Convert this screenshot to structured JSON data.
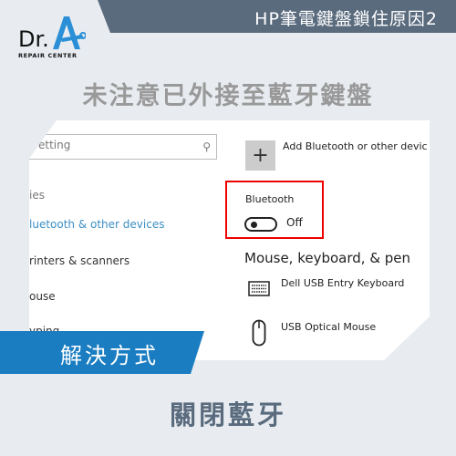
{
  "header": {
    "title": "HP筆電鍵盤鎖住原因2"
  },
  "logo": {
    "text": "Dr.A",
    "subtitle": "REPAIR CENTER"
  },
  "headline": "未注意已外接至藍牙鍵盤",
  "screenshot": {
    "search_placeholder": "etting",
    "sidebar": [
      "ies",
      "luetooth & other devices",
      "rinters & scanners",
      "ouse",
      "yping"
    ],
    "add_device": "Add Bluetooth or other devic",
    "bluetooth_label": "Bluetooth",
    "bluetooth_state": "Off",
    "section_title": "Mouse, keyboard, & pen",
    "devices": [
      "Dell USB Entry Keyboard",
      "USB Optical Mouse"
    ],
    "accent": "#3b8fc4",
    "highlight": "#e00000"
  },
  "banner": "解決方式",
  "solution": "關閉藍牙",
  "colors": {
    "bar": "#5a6b7e",
    "banner": "#1a7dc2",
    "background": "#e8ecf0"
  }
}
